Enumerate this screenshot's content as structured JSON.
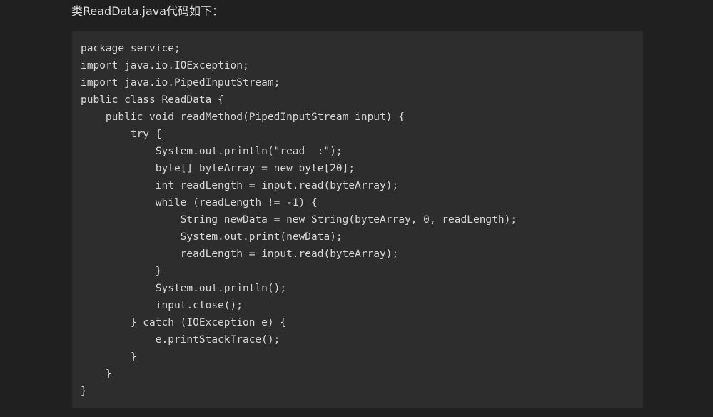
{
  "intro_text": "类ReadData.java代码如下：",
  "code": {
    "language": "java",
    "lines": [
      "package service;",
      "import java.io.IOException;",
      "import java.io.PipedInputStream;",
      "public class ReadData {",
      "    public void readMethod(PipedInputStream input) {",
      "        try {",
      "            System.out.println(\"read  :\");",
      "            byte[] byteArray = new byte[20];",
      "            int readLength = input.read(byteArray);",
      "            while (readLength != -1) {",
      "                String newData = new String(byteArray, 0, readLength);",
      "                System.out.print(newData);",
      "                readLength = input.read(byteArray);",
      "            }",
      "            System.out.println();",
      "            input.close();",
      "        } catch (IOException e) {",
      "            e.printStackTrace();",
      "        }",
      "    }",
      "}"
    ]
  },
  "colors": {
    "page_background": "#202020",
    "code_background": "#2d2d2d",
    "text": "#d6d6d6"
  }
}
